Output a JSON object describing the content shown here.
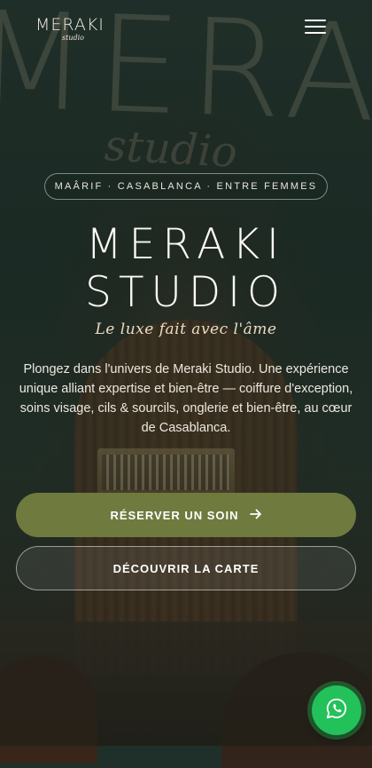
{
  "header": {
    "logo_main": "MERAKI",
    "logo_sub": "studio"
  },
  "background": {
    "wall_text": "MERAKI",
    "wall_subtext": "studio"
  },
  "hero": {
    "location_pill": "MAÂRIF · CASABLANCA · ENTRE FEMMES",
    "title_line1": "MERAKI",
    "title_line2": "STUDIO",
    "tagline": "Le luxe fait avec l'âme",
    "description": "Plongez dans l'univers de Meraki Studio. Une expérience unique alliant expertise et bien-être — coiffure d'exception, soins visage, cils & sourcils, onglerie et bien-être, au cœur de Casablanca."
  },
  "actions": {
    "primary_label": "RÉSERVER UN SOIN",
    "primary_icon": "arrow-right-icon",
    "secondary_label": "DÉCOUVRIR LA CARTE"
  },
  "floating": {
    "whatsapp_icon": "whatsapp-icon"
  },
  "colors": {
    "accent": "#6f7a3f",
    "whatsapp": "#23c15a"
  }
}
